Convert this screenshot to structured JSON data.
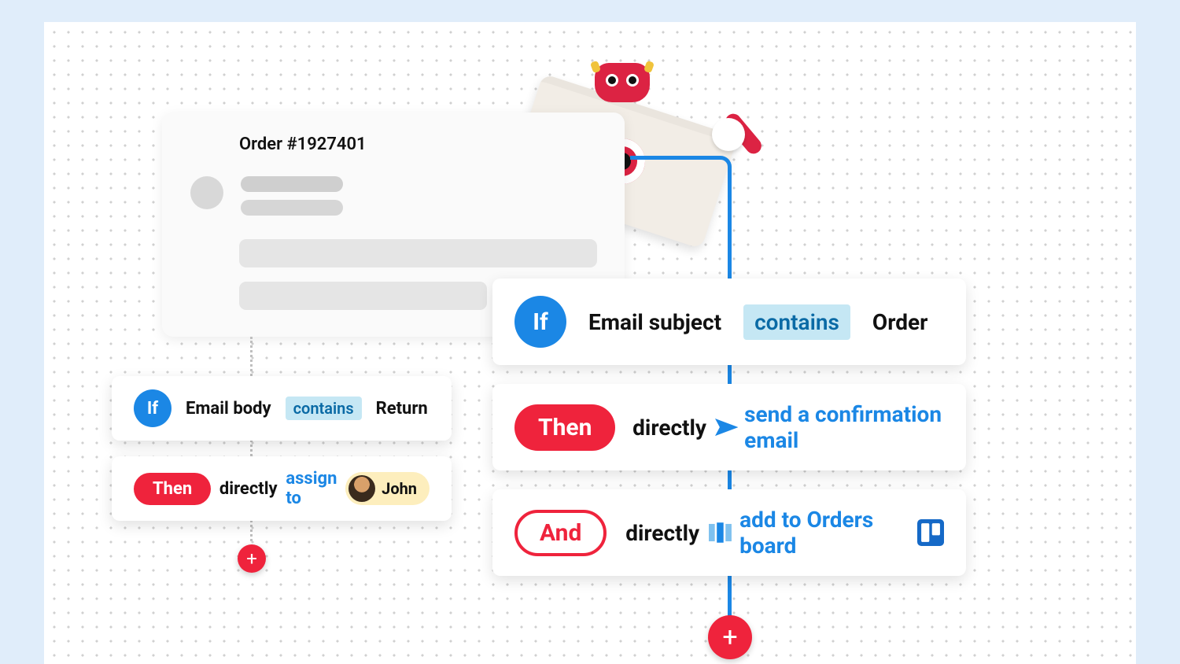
{
  "email": {
    "title": "Order #1927401"
  },
  "leftFlow": {
    "if": {
      "badge": "If",
      "field": "Email body",
      "operator": "contains",
      "value": "Return"
    },
    "then": {
      "badge": "Then",
      "adverb": "directly",
      "action": "assign to",
      "assignee": "John"
    }
  },
  "rightFlow": {
    "if": {
      "badge": "If",
      "field": "Email subject",
      "operator": "contains",
      "value": "Order"
    },
    "then": {
      "badge": "Then",
      "adverb": "directly",
      "action": "send a confirmation email"
    },
    "and": {
      "badge": "And",
      "adverb": "directly",
      "action": "add to Orders board"
    }
  },
  "buttons": {
    "add": "+"
  }
}
